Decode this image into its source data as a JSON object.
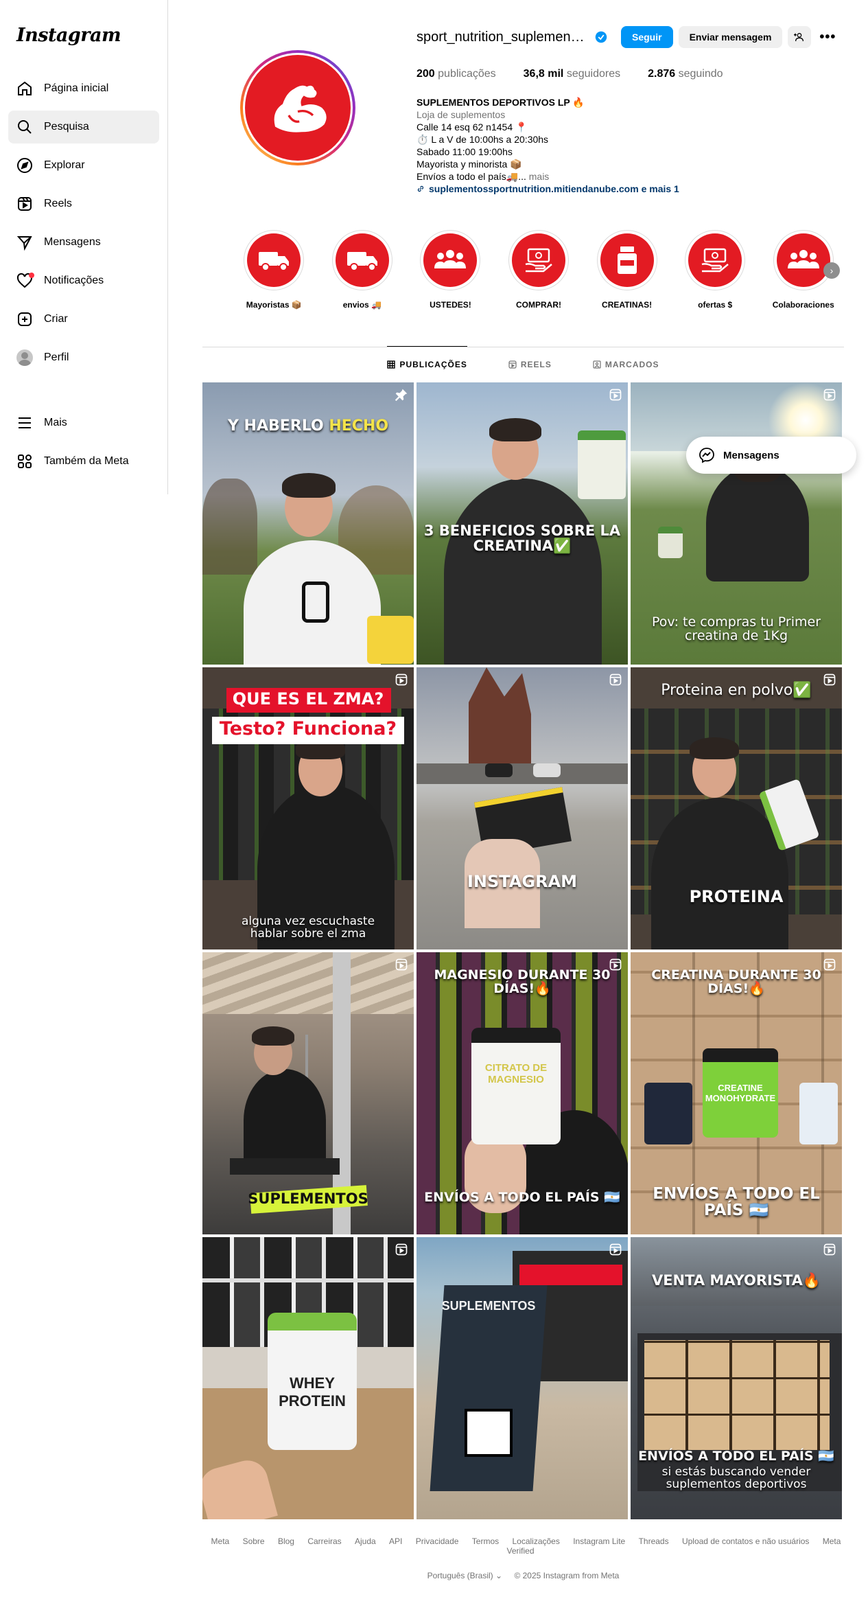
{
  "app": {
    "logo": "Instagram"
  },
  "sidebar": {
    "items": [
      {
        "label": "Página inicial",
        "icon": "home-icon"
      },
      {
        "label": "Pesquisa",
        "icon": "search-icon"
      },
      {
        "label": "Explorar",
        "icon": "compass-icon"
      },
      {
        "label": "Reels",
        "icon": "reels-icon"
      },
      {
        "label": "Mensagens",
        "icon": "messages-icon"
      },
      {
        "label": "Notificações",
        "icon": "heart-icon"
      },
      {
        "label": "Criar",
        "icon": "create-icon"
      },
      {
        "label": "Perfil",
        "icon": "avatar"
      }
    ],
    "bottom": [
      {
        "label": "Mais",
        "icon": "menu-icon"
      },
      {
        "label": "Também da Meta",
        "icon": "meta-icon"
      }
    ],
    "active_index": 1
  },
  "profile": {
    "username": "sport_nutrition_suplementos",
    "follow_label": "Seguir",
    "message_label": "Enviar mensagem",
    "stats": {
      "posts_value": "200",
      "posts_label": "publicações",
      "followers_value": "36,8 mil",
      "followers_label": "seguidores",
      "following_value": "2.876",
      "following_label": "seguindo"
    },
    "bio": {
      "name": "SUPLEMENTOS DEPORTIVOS LP 🔥",
      "category": "Loja de suplementos",
      "line1": "Calle 14 esq 62 n1454 📍",
      "line2": "⏱️ L a V de 10:00hs a 20:30hs",
      "line3": "Sabado 11:00 19:00hs",
      "line4": "Mayorista y minorista 📦",
      "line5": "Envíos a todo el país🚚...",
      "more": " mais",
      "link": "suplementossportnutrition.mitiendanube.com e mais 1"
    }
  },
  "highlights": [
    {
      "label": "Mayoristas 📦",
      "icon": "truck-icon"
    },
    {
      "label": "envios 🚚",
      "icon": "truck-icon"
    },
    {
      "label": "USTEDES!",
      "icon": "group-icon"
    },
    {
      "label": "COMPRAR!",
      "icon": "money-icon"
    },
    {
      "label": "CREATINAS!",
      "icon": "jar-icon"
    },
    {
      "label": "ofertas $",
      "icon": "money-icon"
    },
    {
      "label": "Colaboraciones",
      "icon": "group-icon"
    }
  ],
  "tabs": [
    {
      "label": "PUBLICAÇÕES",
      "icon": "grid-icon"
    },
    {
      "label": "REELS",
      "icon": "reels-icon"
    },
    {
      "label": "MARCADOS",
      "icon": "tagged-icon"
    }
  ],
  "posts": [
    {
      "caption": "Y HABERLO ",
      "caption_hl": "HECHO",
      "badge": "pin-icon"
    },
    {
      "caption": "3 BENEFICIOS SOBRE LA CREATINA✅",
      "badge": "reel-icon"
    },
    {
      "caption": "Pov: te compras tu Primer creatina de 1Kg",
      "badge": "reel-icon"
    },
    {
      "caption_top1": "QUE ES EL ZMA?",
      "caption_top2": "Testo? Funciona?",
      "caption": "alguna vez escuchaste hablar sobre el zma",
      "badge": "reel-icon"
    },
    {
      "caption": "INSTAGRAM",
      "badge": "reel-icon"
    },
    {
      "caption_top": "Proteina en polvo✅",
      "caption": "PROTEINA",
      "badge": "reel-icon"
    },
    {
      "caption": "SUPLEMENTOS",
      "badge": "reel-icon"
    },
    {
      "caption_top": "MAGNESIO DURANTE 30 DÍAS!🔥",
      "caption": "ENVÍOS A TODO EL PAÍS 🇦🇷",
      "product": "CITRATO DE MAGNESIO",
      "badge": "reel-icon"
    },
    {
      "caption_top": "CREATINA DURANTE 30 DÍAS!🔥",
      "caption": "ENVÍOS A TODO EL PAÍS 🇦🇷",
      "product": "CREATINE MONOHYDRATE",
      "badge": "reel-icon"
    },
    {
      "product": "WHEY PROTEIN",
      "badge": "reel-icon"
    },
    {
      "sign": "SUPLEMENTOS",
      "badge": "reel-icon"
    },
    {
      "caption_top": "VENTA MAYORISTA🔥",
      "caption": "ENVÍOS A TODO EL PAÍS 🇦🇷",
      "caption2": "si estás buscando vender suplementos deportivos",
      "badge": "reel-icon"
    }
  ],
  "messages_pill": {
    "label": "Mensagens",
    "icon": "messenger-icon"
  },
  "footer": {
    "links": [
      "Meta",
      "Sobre",
      "Blog",
      "Carreiras",
      "Ajuda",
      "API",
      "Privacidade",
      "Termos",
      "Localizações",
      "Instagram Lite",
      "Threads",
      "Upload de contatos e não usuários",
      "Meta Verified"
    ],
    "language": "Português (Brasil)",
    "copyright": "© 2025 Instagram from Meta"
  },
  "colors": {
    "accent": "#0095f6",
    "brand_red": "#e31b23",
    "verified": "#0095f6"
  }
}
